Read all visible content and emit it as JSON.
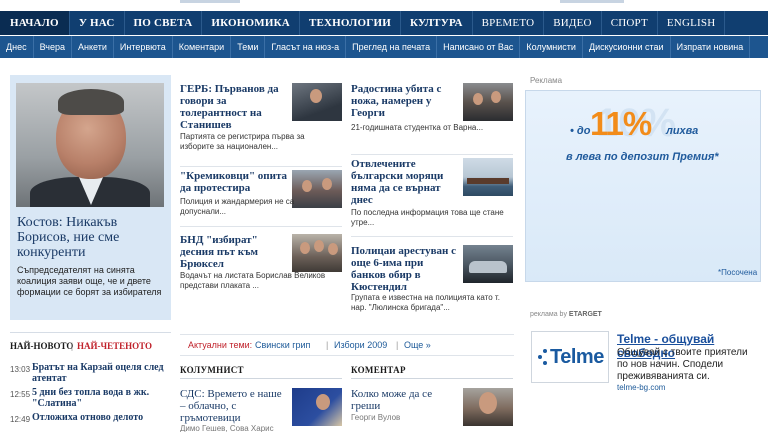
{
  "nav": {
    "main": [
      "НАЧАЛО",
      "У НАС",
      "ПО СВЕТА",
      "ИКОНОМИКА",
      "ТЕХНОЛОГИИ",
      "КУЛТУРА",
      "ВРЕМЕТО",
      "ВИДЕО",
      "СПОРТ",
      "ENGLISH"
    ],
    "sub": [
      "Днес",
      "Вчера",
      "Анкети",
      "Интервюта",
      "Коментари",
      "Теми",
      "Гласът на нюз-а",
      "Преглед на печата",
      "Написано от Вас",
      "Колумнисти",
      "Дискусионни стаи",
      "Изпрати новина"
    ]
  },
  "lead": {
    "headline": "Костов: Никакъв Борисов, ние сме конкуренти",
    "summary": "Съпредседателят на синята коалиция заяви още, че и двете формации се борят за избирателя"
  },
  "latest": {
    "tab_latest": "НАЙ-НОВОТО",
    "tab_sep": "|",
    "tab_read": "НАЙ-ЧЕТЕНОТО",
    "items": [
      {
        "time": "13:03",
        "title": "Братът на Карзай оцеля след атентат"
      },
      {
        "time": "12:55",
        "title": "5 дни без топла вода в жк. \"Слатина\""
      },
      {
        "time": "12:49",
        "title": "Отложиха отново делото"
      }
    ]
  },
  "stories": {
    "col1": [
      {
        "title": "ГЕРБ: Първанов да говори за толерантност на Станишев",
        "text": "Партията се регистрира първа за изборите за националeн..."
      },
      {
        "title": "\"Кремиковци\" опита да протестира",
        "text": "Полиция и жандармерия не са допуснали..."
      },
      {
        "title": "БНД \"избират\" десния път към Брюксел",
        "text": "Водачът на листата Борислав Великов представи плаката ..."
      }
    ],
    "col2": [
      {
        "title": "Радостина убита с ножа, намерен у Георги",
        "text": "21-годишната студентка от Варна..."
      },
      {
        "title": "Отвлечените български моряци няма да се върнат днес",
        "text": "По последна информация това ще стане утре..."
      },
      {
        "title": "Полицаи арестуван с още 6-има при банков обир в Кюстендил",
        "text": "Групата е известна на полицията като т. нар. \"Люлинска бригада\"..."
      }
    ]
  },
  "topics": {
    "label": "Актуални теми:",
    "links": [
      "Свински грип",
      "Избори 2009",
      "Още »"
    ],
    "sep": "|"
  },
  "sections": {
    "columnist": {
      "heading": "КОЛУМНИСТ",
      "title": "СДС: Времето е наше – облачно, с гръмотевици",
      "author": "Димо Гешев, Сова Харис"
    },
    "comment": {
      "heading": "КОМЕНТАР",
      "title": "Колко може да се греши",
      "author": "Георги Вулов"
    }
  },
  "ad": {
    "label": "Реклама",
    "watermark": "10%",
    "prefix": "• до",
    "rate": "11%",
    "rate_word": "лихва",
    "line2": "в лева по депозит Премия*",
    "footnote": "*Посочена"
  },
  "etarget": {
    "prefix": "реклама by",
    "brand": "ETARGET"
  },
  "telme": {
    "logo_text": "Telme",
    "title": "Telme - общувай свободно",
    "text": "Общувай с твоите приятели по нов начин. Сподели преживяванията си.",
    "url": "telme-bg.com"
  },
  "colors": {
    "nav_main": "#103e70",
    "nav_sub": "#1d558f",
    "link": "#1a3a66",
    "accent_red": "#c0232c",
    "ad_orange": "#f28c1a"
  }
}
